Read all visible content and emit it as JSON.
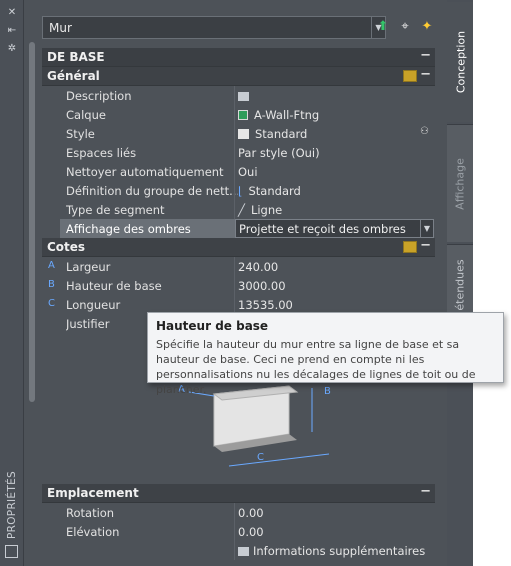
{
  "palette": {
    "side_title": "PROPRIÉTÉS",
    "object_selector": {
      "value": "Mur"
    },
    "tabs": [
      "Conception",
      "Affichage",
      "étendues"
    ],
    "colors": {
      "panel_bg": "#4d5258",
      "strip_bg": "#4b5057",
      "accent_blue": "#6aa9ff",
      "layer_color": "#2f9c5a",
      "tooltip_bg": "#f3f4f6"
    }
  },
  "grid": {
    "section_top": "DE BASE",
    "general": {
      "title": "Général",
      "rows": [
        {
          "key": "Description",
          "value": ""
        },
        {
          "key": "Calque",
          "value": "A-Wall-Ftng"
        },
        {
          "key": "Style",
          "value": "Standard"
        },
        {
          "key": "Espaces liés",
          "value": "Par style (Oui)"
        },
        {
          "key": "Nettoyer automatiquement",
          "value": "Oui"
        },
        {
          "key": "Définition du groupe de nett...",
          "value": "Standard"
        },
        {
          "key": "Type de segment",
          "value": "Ligne"
        },
        {
          "key": "Affichage des ombres",
          "value": "Projette et reçoit des ombres"
        }
      ]
    },
    "cotes": {
      "title": "Cotes",
      "rows": [
        {
          "marker": "A",
          "key": "Largeur",
          "value": "240.00"
        },
        {
          "marker": "B",
          "key": "Hauteur de base",
          "value": "3000.00"
        },
        {
          "marker": "C",
          "key": "Longueur",
          "value": "13535.00"
        },
        {
          "marker": "",
          "key": "Justifier",
          "value": ""
        }
      ],
      "diagram_labels": [
        "A",
        "B",
        "C"
      ]
    },
    "emplacement": {
      "title": "Emplacement",
      "rows": [
        {
          "key": "Rotation",
          "value": "0.00"
        },
        {
          "key": "Elévation",
          "value": "0.00"
        }
      ],
      "extra_link": "Informations supplémentaires"
    }
  },
  "tooltip": {
    "title": "Hauteur de base",
    "body": "Spécifie la hauteur du mur entre sa ligne de base et sa hauteur de base. Ceci ne prend en compte ni les personnalisations nu les décalages de lignes de toit ou de plancher."
  }
}
